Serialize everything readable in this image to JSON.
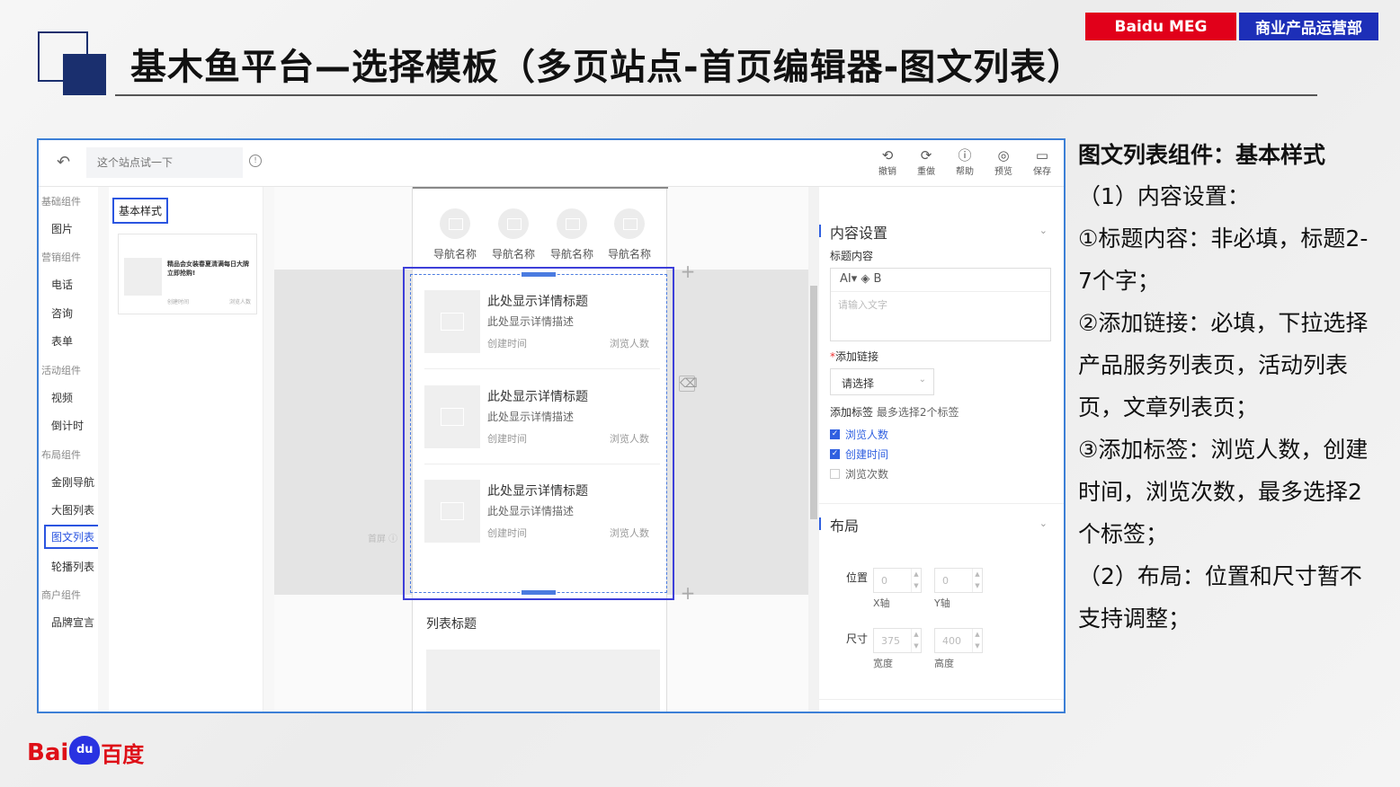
{
  "slide": {
    "title": "基木鱼平台—选择模板（多页站点-首页编辑器-图文列表）",
    "brand_left": "Baidu MEG",
    "brand_right": "商业产品运营部"
  },
  "toolbar": {
    "site_input_placeholder": "这个站点试一下",
    "tools": [
      {
        "icon": "undo-icon",
        "label": "撤销"
      },
      {
        "icon": "redo-icon",
        "label": "重做"
      },
      {
        "icon": "help-icon",
        "label": "帮助"
      },
      {
        "icon": "preview-icon",
        "label": "预览"
      },
      {
        "icon": "save-icon",
        "label": "保存"
      }
    ]
  },
  "left_nav": {
    "groups": [
      {
        "label": "基础组件",
        "items": [
          "图片"
        ]
      },
      {
        "label": "营销组件",
        "items": [
          "电话",
          "咨询",
          "表单"
        ]
      },
      {
        "label": "活动组件",
        "items": [
          "视频",
          "倒计时"
        ]
      },
      {
        "label": "布局组件",
        "items": [
          "金刚导航",
          "大图列表",
          "图文列表",
          "轮播列表"
        ]
      },
      {
        "label": "商户组件",
        "items": [
          "品牌宣言"
        ]
      }
    ],
    "active_item": "图文列表"
  },
  "style_panel": {
    "tag": "基本样式",
    "card_title": "精品会女装春夏清满每日大牌立即抢购!",
    "card_meta_left": "创建时间",
    "card_meta_right": "浏览人数"
  },
  "canvas": {
    "nav_items": [
      "导航名称",
      "导航名称",
      "导航名称",
      "导航名称"
    ],
    "list_items": [
      {
        "title": "此处显示详情标题",
        "desc": "此处显示详情描述",
        "time": "创建时间",
        "views": "浏览人数"
      },
      {
        "title": "此处显示详情标题",
        "desc": "此处显示详情描述",
        "time": "创建时间",
        "views": "浏览人数"
      },
      {
        "title": "此处显示详情标题",
        "desc": "此处显示详情描述",
        "time": "创建时间",
        "views": "浏览人数"
      }
    ],
    "screen_label": "首屏 ⓘ",
    "list_title": "列表标题"
  },
  "props": {
    "content_section": "内容设置",
    "title_label": "标题内容",
    "editor_toolbar": "AI▾   ◈   B",
    "editor_placeholder": "请输入文字",
    "link_label": "添加链接",
    "link_required": "*",
    "link_select": "请选择",
    "tag_label": "添加标签",
    "tag_hint": "最多选择2个标签",
    "tags": [
      {
        "label": "浏览人数",
        "checked": true
      },
      {
        "label": "创建时间",
        "checked": true
      },
      {
        "label": "浏览次数",
        "checked": false
      }
    ],
    "layout_section": "布局",
    "position_label": "位置",
    "x_value": "0",
    "y_value": "0",
    "x_caption": "X轴",
    "y_caption": "Y轴",
    "size_label": "尺寸",
    "width_value": "375",
    "height_value": "400",
    "width_caption": "宽度",
    "height_caption": "高度"
  },
  "notes": {
    "heading": "图文列表组件：基本样式",
    "lines": [
      "（1）内容设置：",
      "①标题内容：非必填，标题2-7个字；",
      "②添加链接：必填，下拉选择产品服务列表页，活动列表页，文章列表页；",
      "③添加标签：浏览人数，创建时间，浏览次数，最多选择2个标签；",
      "（2）布局：位置和尺寸暂不支持调整；"
    ]
  },
  "footer_logo": {
    "bai": "Bai",
    "du": "du",
    "cn": "百度"
  },
  "colors": {
    "accent_blue": "#3d3fd9",
    "brand_red": "#e1001a",
    "brand_blue": "#1d2fb8",
    "navy": "#1a2f6e"
  }
}
